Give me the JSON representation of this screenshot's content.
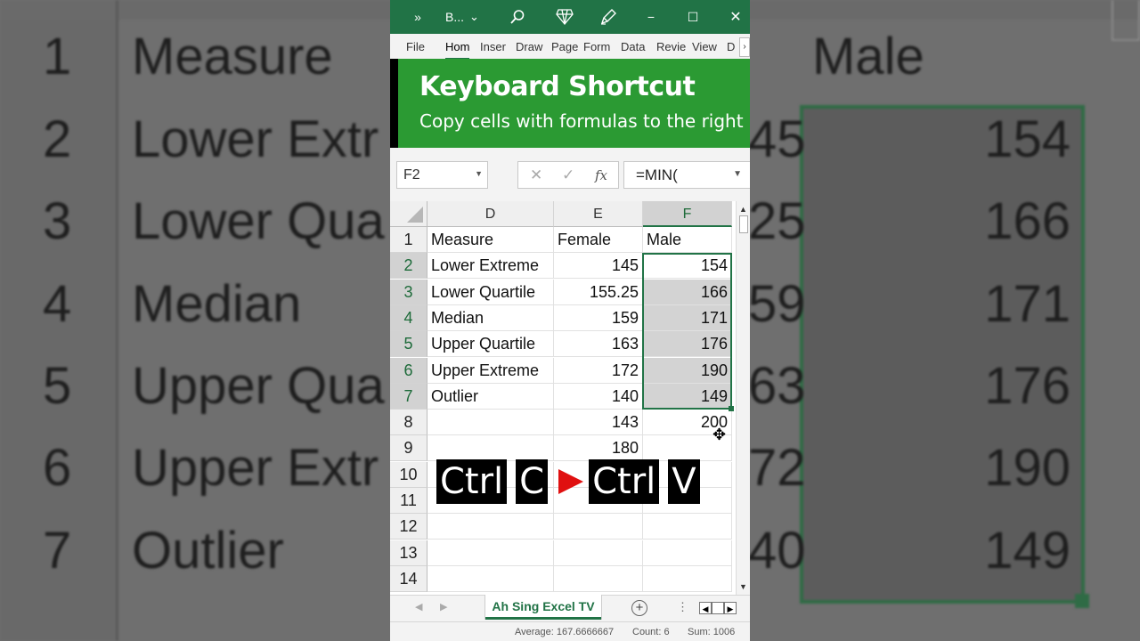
{
  "background": {
    "rows": [
      {
        "num": "1",
        "label": "Measure",
        "mid": "",
        "value": "Male"
      },
      {
        "num": "2",
        "label": "Lower Extr",
        "mid": "45",
        "value": "154"
      },
      {
        "num": "3",
        "label": "Lower Qua",
        "mid": "25",
        "value": "166"
      },
      {
        "num": "4",
        "label": "Median",
        "mid": "59",
        "value": "171"
      },
      {
        "num": "5",
        "label": "Upper Qua",
        "mid": "63",
        "value": "176"
      },
      {
        "num": "6",
        "label": "Upper Extr",
        "mid": "72",
        "value": "190"
      },
      {
        "num": "7",
        "label": "Outlier",
        "mid": "40",
        "value": "149"
      }
    ]
  },
  "titlebar": {
    "more": "»",
    "book_name": "B...",
    "title_dropdown": "⌄",
    "minimize": "−",
    "maximize": "☐",
    "close": "✕"
  },
  "ribbon_tabs": [
    "File",
    "Hom",
    "Inser",
    "Draw",
    "Page",
    "Form",
    "Data",
    "Revie",
    "View",
    "D"
  ],
  "ribbon_active": "Hom",
  "ribbon_scroll": "›",
  "banner": {
    "title": "Keyboard Shortcut",
    "subtitle": "Copy cells with formulas to the right"
  },
  "formula_bar": {
    "name_box": "F2",
    "cancel": "✕",
    "enter": "✓",
    "fx": "fx",
    "formula": "=MIN(",
    "dropdown": "⌄"
  },
  "columns": [
    {
      "label": "D",
      "selected": false
    },
    {
      "label": "E",
      "selected": false
    },
    {
      "label": "F",
      "selected": true
    }
  ],
  "rows": [
    {
      "num": "1",
      "d": "Measure",
      "e": "Female",
      "f": "Male",
      "sel": false
    },
    {
      "num": "2",
      "d": "Lower Extreme",
      "e": "145",
      "f": "154",
      "sel": true
    },
    {
      "num": "3",
      "d": "Lower Quartile",
      "e": "155.25",
      "f": "166",
      "sel": true
    },
    {
      "num": "4",
      "d": "Median",
      "e": "159",
      "f": "171",
      "sel": true
    },
    {
      "num": "5",
      "d": "Upper Quartile",
      "e": "163",
      "f": "176",
      "sel": true
    },
    {
      "num": "6",
      "d": "Upper Extreme",
      "e": "172",
      "f": "190",
      "sel": true
    },
    {
      "num": "7",
      "d": "Outlier",
      "e": "140",
      "f": "149",
      "sel": true
    },
    {
      "num": "8",
      "d": "",
      "e": "143",
      "f": "200",
      "sel": false
    },
    {
      "num": "9",
      "d": "",
      "e": "180",
      "f": "",
      "sel": false
    },
    {
      "num": "10",
      "d": "",
      "e": "",
      "f": "",
      "sel": false
    },
    {
      "num": "11",
      "d": "",
      "e": "",
      "f": "",
      "sel": false
    },
    {
      "num": "12",
      "d": "",
      "e": "",
      "f": "",
      "sel": false
    },
    {
      "num": "13",
      "d": "",
      "e": "",
      "f": "",
      "sel": false
    },
    {
      "num": "14",
      "d": "",
      "e": "",
      "f": "",
      "sel": false
    }
  ],
  "shortcut": {
    "key1": "Ctrl",
    "key2": "C",
    "key3": "Ctrl",
    "key4": "V"
  },
  "sheet_tab": "Ah Sing Excel TV",
  "sheetbar": {
    "prev": "◀",
    "next": "▶",
    "add": "+",
    "more": "⋮",
    "scroll_left": "◀",
    "scroll_right": "▶"
  },
  "status": {
    "average": "Average: 167.6666667",
    "count": "Count: 6",
    "sum": "Sum: 1006"
  },
  "colors": {
    "excel_green": "#217346",
    "banner_green": "#2b9a33",
    "play_red": "#e01010"
  }
}
